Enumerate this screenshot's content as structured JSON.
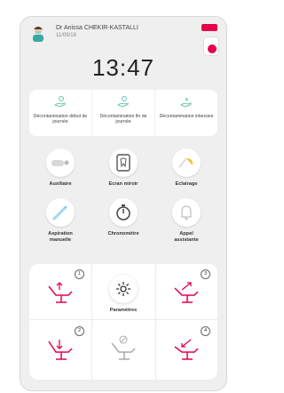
{
  "header": {
    "doctor_name": "Dr Anissa CHEKIR-KASTALLI",
    "date": "11/09/18",
    "battery_color": "#e6004c",
    "accent_color": "#e6004c"
  },
  "clock": {
    "time": "13:47"
  },
  "decontamination": [
    {
      "label": "Décontamination début de journée",
      "icon": "hand-sanitize-icon"
    },
    {
      "label": "Décontamination fin de journée",
      "icon": "hand-sanitize-icon"
    },
    {
      "label": "Décontamination intensive",
      "icon": "hand-spray-icon"
    }
  ],
  "tiles": [
    {
      "label": "Auxiliaire",
      "icon": "auxiliary-instrument-icon"
    },
    {
      "label": "Ecran miroir",
      "icon": "mirror-screen-icon"
    },
    {
      "label": "Eclairage",
      "icon": "lamp-icon"
    },
    {
      "label": "Aspiration manuelle",
      "icon": "suction-icon"
    },
    {
      "label": "Chronomètre",
      "icon": "stopwatch-icon"
    },
    {
      "label": "Appel assistante",
      "icon": "bell-icon"
    }
  ],
  "chairs": [
    {
      "number": "1",
      "icon": "chair-position-1-icon"
    },
    {
      "number": "3",
      "icon": "chair-position-3-icon"
    },
    {
      "number": "2",
      "icon": "chair-position-2-icon"
    },
    {
      "number": "",
      "icon": "chair-disabled-icon"
    },
    {
      "number": "4",
      "icon": "chair-position-4-icon"
    }
  ],
  "settings": {
    "label": "Paramètres",
    "icon": "gear-icon"
  }
}
